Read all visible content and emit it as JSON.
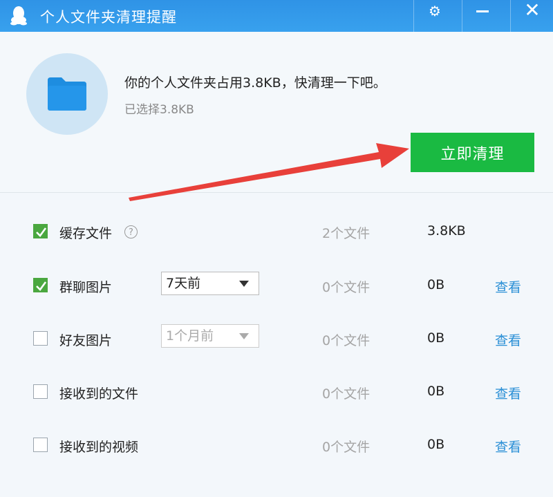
{
  "window": {
    "title": "个人文件夹清理提醒",
    "settings_glyph": "⚙",
    "close_glyph": "✕"
  },
  "summary": {
    "main_text": "你的个人文件夹占用3.8KB，快清理一下吧。",
    "selected_text": "已选择3.8KB"
  },
  "clean_button_label": "立即清理",
  "help_glyph": "?",
  "rows": [
    {
      "label": "缓存文件",
      "checked": true,
      "count": "2个文件",
      "size": "3.8KB"
    },
    {
      "label": "群聊图片",
      "checked": true,
      "dropdown": "7天前",
      "count": "0个文件",
      "size": "0B",
      "view": "查看"
    },
    {
      "label": "好友图片",
      "checked": false,
      "dropdown": "1个月前",
      "count": "0个文件",
      "size": "0B",
      "view": "查看"
    },
    {
      "label": "接收到的文件",
      "checked": false,
      "count": "0个文件",
      "size": "0B",
      "view": "查看"
    },
    {
      "label": "接收到的视频",
      "checked": false,
      "count": "0个文件",
      "size": "0B",
      "view": "查看"
    }
  ],
  "colors": {
    "title_bar": "#2f93e6",
    "clean_button": "#1aba42",
    "checkbox_checked": "#4aa73f",
    "link": "#2a8fd6",
    "annotation_arrow": "#e8403a"
  },
  "icons": [
    "qq-penguin-icon",
    "gear-icon",
    "minimize-icon",
    "close-icon",
    "folder-icon",
    "help-icon",
    "check-icon",
    "chevron-down-icon"
  ]
}
